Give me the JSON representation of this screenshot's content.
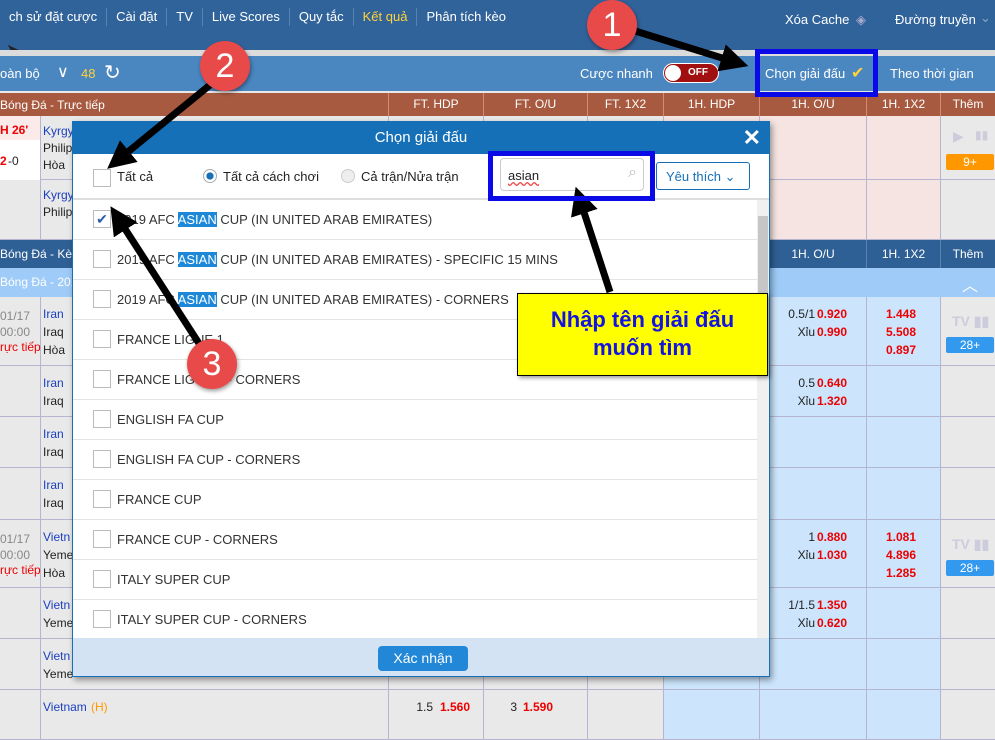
{
  "nav": {
    "items": [
      "ch sử đặt cược",
      "Cài đặt",
      "TV",
      "Live Scores",
      "Quy tắc",
      "Kết quả",
      "Phân tích kèo"
    ],
    "active": "Kết quả",
    "clear_cache": "Xóa Cache",
    "connection": "Đường truyền"
  },
  "toolbar": {
    "all": "oàn bộ",
    "count": "48",
    "quick_bet": "Cược nhanh",
    "toggle": "OFF",
    "choose_league": "Chọn giải đấu",
    "sort": "Theo thời gian"
  },
  "columns": [
    "FT. HDP",
    "FT. O/U",
    "FT. 1X2",
    "1H. HDP",
    "1H. O/U",
    "1H. 1X2",
    "Thêm"
  ],
  "sections": {
    "live": "Bóng Đá - Trực tiếp",
    "odds": "Bóng Đá - Kèo",
    "league": "Bóng Đá - 201"
  },
  "live_rows": [
    {
      "time": "H 26'",
      "score": "2",
      "score2": "-0",
      "teams": [
        "Kyrgy",
        "Philip",
        "Hòa"
      ],
      "more": "9+"
    },
    {
      "teams": [
        "Kyrgy",
        "Philip"
      ]
    }
  ],
  "rows": [
    {
      "date": "01/17",
      "clock": "00:00",
      "status": "rực tiếp",
      "teams": [
        "Iran",
        "Iraq",
        "Hòa"
      ],
      "ou": [
        [
          "0.5/1",
          "0.920"
        ],
        [
          "Xỉu",
          "0.990"
        ]
      ],
      "x12": [
        "1.448",
        "5.508",
        "0.897"
      ],
      "more": "28+"
    },
    {
      "teams": [
        "Iran",
        "Iraq"
      ],
      "ou": [
        [
          "0.5",
          "0.640"
        ],
        [
          "Xỉu",
          "1.320"
        ]
      ]
    },
    {
      "teams": [
        "Iran",
        "Iraq"
      ]
    },
    {
      "teams": [
        "Iran",
        "Iraq"
      ]
    },
    {
      "date": "01/17",
      "clock": "00:00",
      "status": "rực tiếp",
      "teams": [
        "Vietn",
        "Yeme",
        "Hòa"
      ],
      "ou": [
        [
          "1",
          "0.880"
        ],
        [
          "Xỉu",
          "1.030"
        ]
      ],
      "x12": [
        "1.081",
        "4.896",
        "1.285"
      ],
      "more": "28+"
    },
    {
      "teams": [
        "Vietn",
        "Yeme"
      ],
      "ou": [
        [
          "1/1.5",
          "1.350"
        ],
        [
          "Xỉu",
          "0.620"
        ]
      ]
    },
    {
      "teams": [
        "Vietn",
        "Yeme"
      ]
    },
    {
      "teams": [
        "Vietnam"
      ],
      "home": "(H)",
      "ft_hdp": [
        "1.5",
        "1.560"
      ],
      "ft_ou": [
        "3",
        "1.590"
      ]
    }
  ],
  "modal": {
    "title": "Chọn giải đấu",
    "select_all": "Tất cả",
    "opt_all": "Tất cả cách chơi",
    "opt_half": "Cả trận/Nửa trận",
    "search_value": "asian",
    "favorites": "Yêu thích",
    "confirm": "Xác nhận",
    "leagues": [
      {
        "pre": "2019 AFC ",
        "hl": "ASIAN",
        "post": " CUP (IN UNITED ARAB EMIRATES)",
        "checked": true
      },
      {
        "pre": "2019 AFC ",
        "hl": "ASIAN",
        "post": " CUP (IN UNITED ARAB EMIRATES) - SPECIFIC 15 MINS"
      },
      {
        "pre": "2019 AFC ",
        "hl": "ASIAN",
        "post": " CUP (IN UNITED ARAB EMIRATES) - CORNERS"
      },
      {
        "pre": "FRANCE LIGUE 1"
      },
      {
        "pre": "FRANCE LIGUE 1 - CORNERS"
      },
      {
        "pre": "ENGLISH FA CUP"
      },
      {
        "pre": "ENGLISH FA CUP - CORNERS"
      },
      {
        "pre": "FRANCE CUP"
      },
      {
        "pre": "FRANCE CUP - CORNERS"
      },
      {
        "pre": "ITALY SUPER CUP"
      },
      {
        "pre": "ITALY SUPER CUP - CORNERS"
      }
    ]
  },
  "annotations": {
    "n1": "1",
    "n2": "2",
    "n3": "3",
    "callout": "Nhập tên giải đấu muốn tìm"
  },
  "colors": {
    "highlight_box": "#0a0ae8",
    "callout_bg": "#ffff00",
    "marker": "#e84a4a",
    "header_live": "#a85a40",
    "header": "#31639b"
  }
}
